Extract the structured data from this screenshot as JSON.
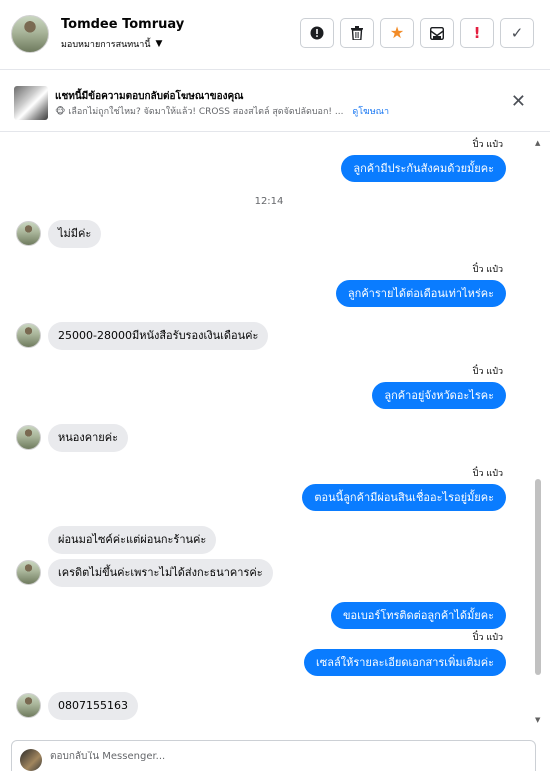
{
  "header": {
    "name": "Tomdee Tomruay",
    "assign_label": "มอบหมายการสนทนานี้",
    "actions": [
      {
        "name": "report-icon",
        "glyph": "!"
      },
      {
        "name": "trash-icon",
        "glyph": "trash"
      },
      {
        "name": "star-icon",
        "glyph": "★",
        "color": "#f28c28"
      },
      {
        "name": "archive-envelope-icon",
        "glyph": "envelope"
      },
      {
        "name": "important-icon",
        "glyph": "!",
        "color": "#e41e3f"
      },
      {
        "name": "check-icon",
        "glyph": "✓"
      }
    ]
  },
  "ad": {
    "title": "แชทนี้มีข้อความตอบกลับต่อโฆษณาของคุณ",
    "text": "🐵 เลือกไม่ถูกใช่ไหม? จัดมาให้แล้ว! CROSS สองสไตล์ สุดจัดปลัดบอก! ...",
    "link": "ดูโฆษณา"
  },
  "messages": {
    "sender_name": "ปิ๋ว แป๋ว",
    "time": "12:14",
    "out_1": "ลูกค้ามีประกันสังคมด้วยมั้ยคะ",
    "in_1": "ไม่มีค่ะ",
    "out_2": "ลูกค้ารายได้ต่อเดือนเท่าไหร่คะ",
    "in_2": "25000-28000มีหนังสือรับรองเงินเดือนค่ะ",
    "out_3": "ลูกค้าอยู่จังหวัดอะไรคะ",
    "in_3": "หนองคายค่ะ",
    "out_4": "ตอนนี้ลูกค้ามีผ่อนสินเชื่ออะไรอยู่มั้ยคะ",
    "in_4a": "ผ่อนมอไซค์ค่ะแต่ผ่อนกะร้านค่ะ",
    "in_4b": "เครดิตไม่ขึ้นค่ะเพราะไม่ได้ส่งกะธนาคารค่ะ",
    "out_5": "ขอเบอร์โทรติดต่อลูกค้าได้มั้ยคะ",
    "out_6": "เซลล์ให้รายละเอียดเอกสารเพิ่มเติมค่ะ",
    "in_5": "0807155163"
  },
  "composer": {
    "placeholder": "ตอบกลับใน Messenger..."
  },
  "colors": {
    "accent": "#0a7cff",
    "incoming_bubble": "#e9eaed"
  }
}
